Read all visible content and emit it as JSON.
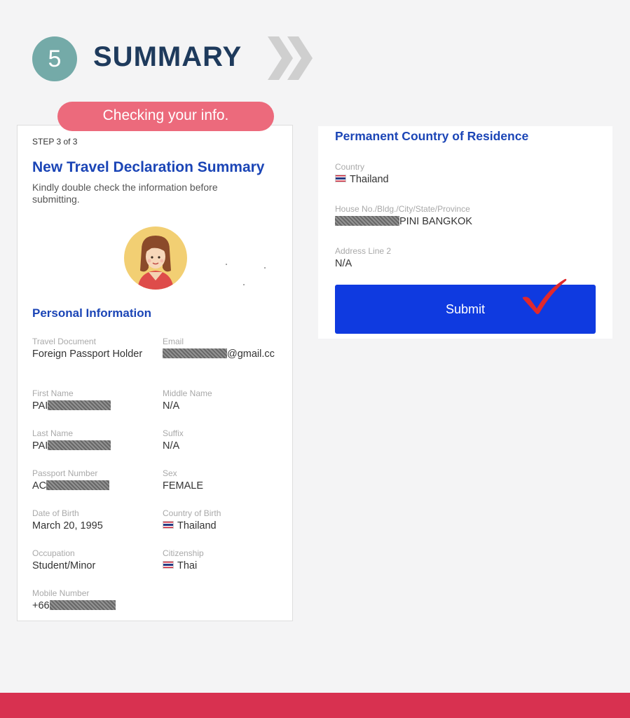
{
  "header": {
    "step_number": "5",
    "title": "SUMMARY"
  },
  "pill": {
    "label": "Checking your info."
  },
  "left_card": {
    "step_label": "STEP 3 of 3",
    "heading": "New Travel Declaration Summary",
    "description": "Kindly double check the information before submitting.",
    "section_title": "Personal Information",
    "fields": {
      "travel_document": {
        "label": "Travel Document",
        "value": "Foreign Passport Holder"
      },
      "email": {
        "label": "Email",
        "value": "@gmail.cc"
      },
      "first_name": {
        "label": "First Name",
        "value": "PAI"
      },
      "middle_name": {
        "label": "Middle Name",
        "value": "N/A"
      },
      "last_name": {
        "label": "Last Name",
        "value": "PAI"
      },
      "suffix": {
        "label": "Suffix",
        "value": "N/A"
      },
      "passport_number": {
        "label": "Passport Number",
        "value": "AC"
      },
      "sex": {
        "label": "Sex",
        "value": "FEMALE"
      },
      "date_of_birth": {
        "label": "Date of Birth",
        "value": "March 20, 1995"
      },
      "country_of_birth": {
        "label": "Country of Birth",
        "value": "Thailand"
      },
      "occupation": {
        "label": "Occupation",
        "value": "Student/Minor"
      },
      "citizenship": {
        "label": "Citizenship",
        "value": "Thai"
      },
      "mobile_number": {
        "label": "Mobile Number",
        "value": "+66"
      }
    }
  },
  "right_card": {
    "heading": "Permanent Country of Residence",
    "fields": {
      "country": {
        "label": "Country",
        "value": "Thailand"
      },
      "address": {
        "label": "House No./Bldg./City/State/Province",
        "value": "PINI BANGKOK"
      },
      "address_line_2": {
        "label": "Address Line 2",
        "value": "N/A"
      }
    },
    "submit_label": "Submit"
  },
  "icons": {
    "chevrons": "double-chevron-right-icon",
    "check": "checkmark-icon",
    "flag": "thailand-flag-icon",
    "avatar": "user-avatar-female"
  },
  "colors": {
    "step_circle": "#74aaa8",
    "title": "#1e3a5c",
    "pill": "#ec6a7c",
    "heading_blue": "#1b45b6",
    "submit": "#0f3ae0",
    "checkmark": "#e0282c",
    "bottom_band": "#d83150"
  }
}
